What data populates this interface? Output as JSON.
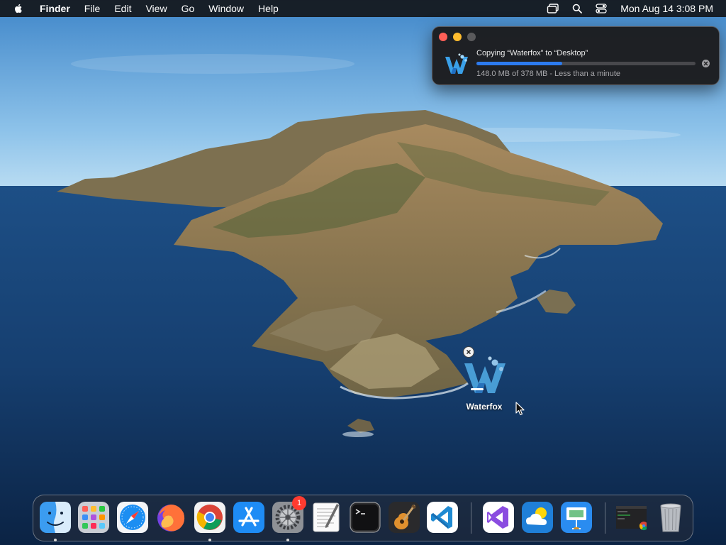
{
  "menubar": {
    "apple_icon": "apple-logo-icon",
    "app_name": "Finder",
    "menus": [
      "File",
      "Edit",
      "View",
      "Go",
      "Window",
      "Help"
    ],
    "status_icons": [
      "stage-manager-icon",
      "spotlight-search-icon",
      "control-center-icon"
    ],
    "clock": "Mon Aug 14  3:08 PM"
  },
  "copy_window": {
    "title": "Copying “Waterfox” to “Desktop”",
    "status": "148.0 MB of 378 MB - Less than a minute",
    "progress_fraction": 0.39,
    "icon": "waterfox-icon",
    "colors": {
      "progress": "#2c7bf0",
      "close": "#ff5f57",
      "minimize": "#febc2e"
    }
  },
  "desktop_icon": {
    "label": "Waterfox",
    "icon": "waterfox-icon"
  },
  "dock": {
    "settings_badge": "1",
    "apps": [
      {
        "name": "Finder",
        "icon": "finder-icon",
        "running": true
      },
      {
        "name": "Launchpad",
        "icon": "launchpad-icon",
        "running": false
      },
      {
        "name": "Safari",
        "icon": "safari-icon",
        "running": false
      },
      {
        "name": "Firefox",
        "icon": "firefox-icon",
        "running": false
      },
      {
        "name": "Google Chrome",
        "icon": "chrome-icon",
        "running": true
      },
      {
        "name": "App Store",
        "icon": "app-store-icon",
        "running": false
      },
      {
        "name": "System Settings",
        "icon": "settings-gear-icon",
        "running": true
      },
      {
        "name": "TextEdit",
        "icon": "textedit-icon",
        "running": false
      },
      {
        "name": "Terminal",
        "icon": "terminal-icon",
        "running": false
      },
      {
        "name": "GarageBand",
        "icon": "garageband-icon",
        "running": false
      },
      {
        "name": "Visual Studio Code",
        "icon": "vscode-icon",
        "running": false
      },
      {
        "name": "Visual Studio",
        "icon": "visual-studio-icon",
        "running": false
      },
      {
        "name": "Weather",
        "icon": "weather-icon",
        "running": false
      },
      {
        "name": "Keynote",
        "icon": "keynote-icon",
        "running": false
      },
      {
        "name": "Chrome Window",
        "icon": "chrome-window-thumbnail-icon",
        "running": false
      },
      {
        "name": "Trash",
        "icon": "trash-icon",
        "running": false
      }
    ]
  }
}
